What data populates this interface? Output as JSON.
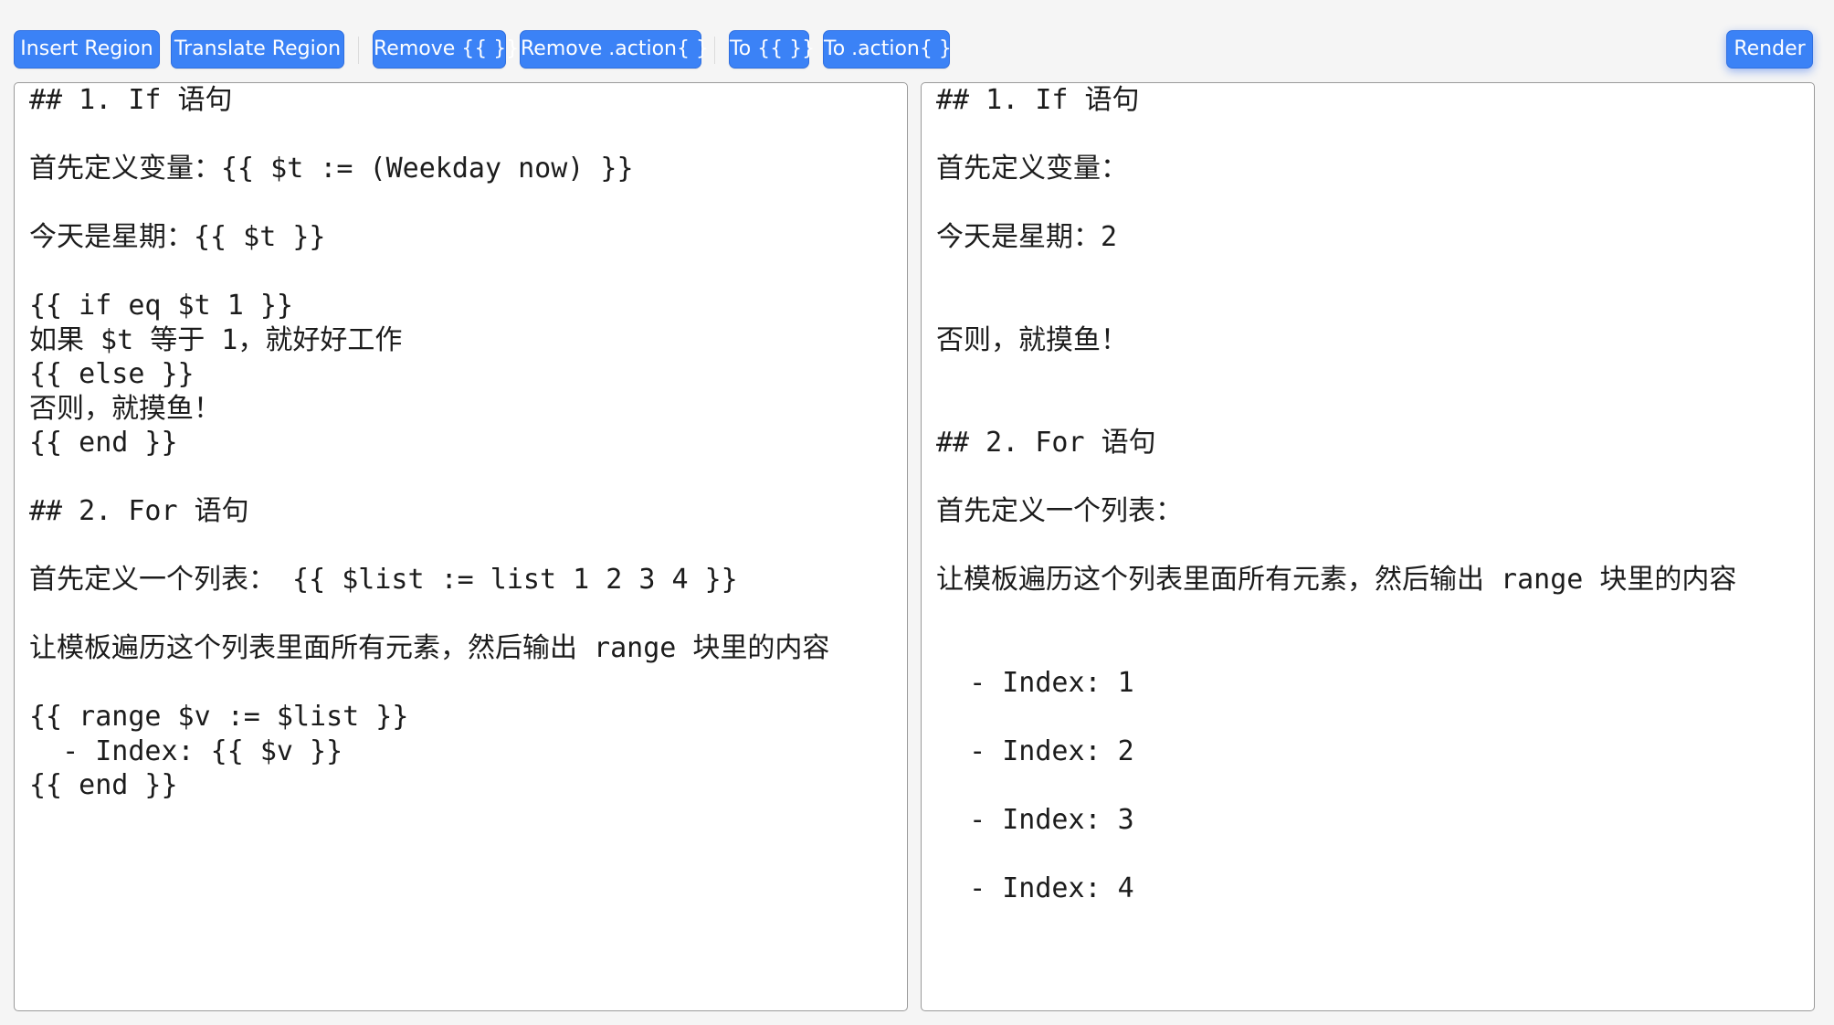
{
  "toolbar": {
    "insert_region": "Insert Region",
    "translate_region": "Translate Region",
    "remove_braces": "Remove {{ }}",
    "remove_action": "Remove .action{ }",
    "to_braces": "To {{ }}",
    "to_action": "To .action{ }",
    "render": "Render"
  },
  "editor": {
    "lines": [
      "## 1. If 语句",
      "",
      "首先定义变量：{{ $t := (Weekday now) }}",
      "",
      "今天是星期：{{ $t }}",
      "",
      "{{ if eq $t 1 }}",
      "如果 $t 等于 1，就好好工作",
      "{{ else }}",
      "否则，就摸鱼！",
      "{{ end }}",
      "",
      "## 2. For 语句",
      "",
      "首先定义一个列表： {{ $list := list 1 2 3 4 }}",
      "",
      "让模板遍历这个列表里面所有元素，然后输出 range 块里的内容",
      "",
      "{{ range $v := $list }}",
      "  - Index: {{ $v }}",
      "{{ end }}"
    ]
  },
  "preview": {
    "lines": [
      "## 1. If 语句",
      "",
      "首先定义变量：",
      "",
      "今天是星期：2",
      "",
      "",
      "否则，就摸鱼！",
      "",
      "",
      "## 2. For 语句",
      "",
      "首先定义一个列表：",
      "",
      "让模板遍历这个列表里面所有元素，然后输出 range 块里的内容",
      "",
      "",
      "  - Index: 1",
      "",
      "  - Index: 2",
      "",
      "  - Index: 3",
      "",
      "  - Index: 4"
    ]
  },
  "colors": {
    "button": "#3b82f6",
    "button_text": "#ffffff",
    "page_background": "#f5f5f5",
    "pane_border": "#9a9a9a"
  }
}
